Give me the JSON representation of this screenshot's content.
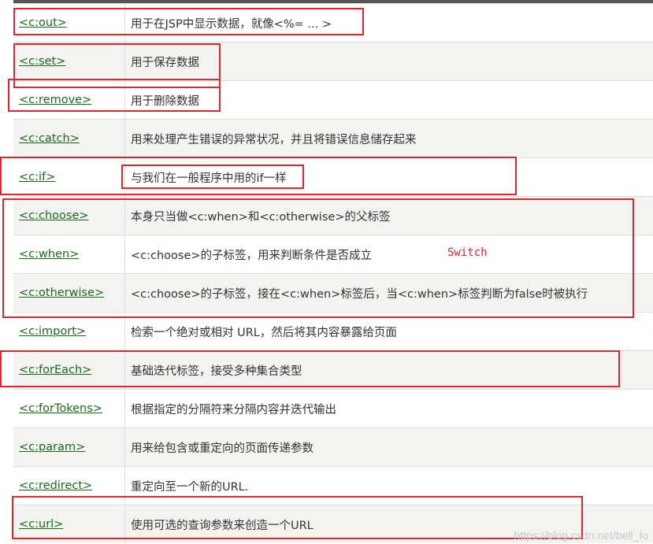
{
  "rows": [
    {
      "tag": "<c:out>",
      "desc": "用于在JSP中显示数据，就像<%= ... >"
    },
    {
      "tag": "<c:set>",
      "desc": "用于保存数据"
    },
    {
      "tag": "<c:remove>",
      "desc": "用于删除数据"
    },
    {
      "tag": "<c:catch>",
      "desc": "用来处理产生错误的异常状况，并且将错误信息储存起来"
    },
    {
      "tag": "<c:if>",
      "desc": "与我们在一般程序中用的if一样"
    },
    {
      "tag": "<c:choose>",
      "desc": "本身只当做<c:when>和<c:otherwise>的父标签"
    },
    {
      "tag": "<c:when>",
      "desc": "<c:choose>的子标签，用来判断条件是否成立"
    },
    {
      "tag": "<c:otherwise>",
      "desc": "<c:choose>的子标签，接在<c:when>标签后，当<c:when>标签判断为false时被执行"
    },
    {
      "tag": "<c:import>",
      "desc": "检索一个绝对或相对 URL，然后将其内容暴露给页面"
    },
    {
      "tag": "<c:forEach>",
      "desc": "基础迭代标签，接受多种集合类型"
    },
    {
      "tag": "<c:forTokens>",
      "desc": "根据指定的分隔符来分隔内容并迭代输出"
    },
    {
      "tag": "<c:param>",
      "desc": "用来给包含或重定向的页面传递参数"
    },
    {
      "tag": "<c:redirect>",
      "desc": "重定向至一个新的URL."
    },
    {
      "tag": "<c:url>",
      "desc": "使用可选的查询参数来创造一个URL"
    }
  ],
  "annotation": "Switch",
  "watermark": "https://blog.csdn.net/bell_fo",
  "colors": {
    "highlight": "#e0262c",
    "link": "#1a6a1a",
    "stripe": "#f3f3f1",
    "header_bar": "#555555"
  }
}
